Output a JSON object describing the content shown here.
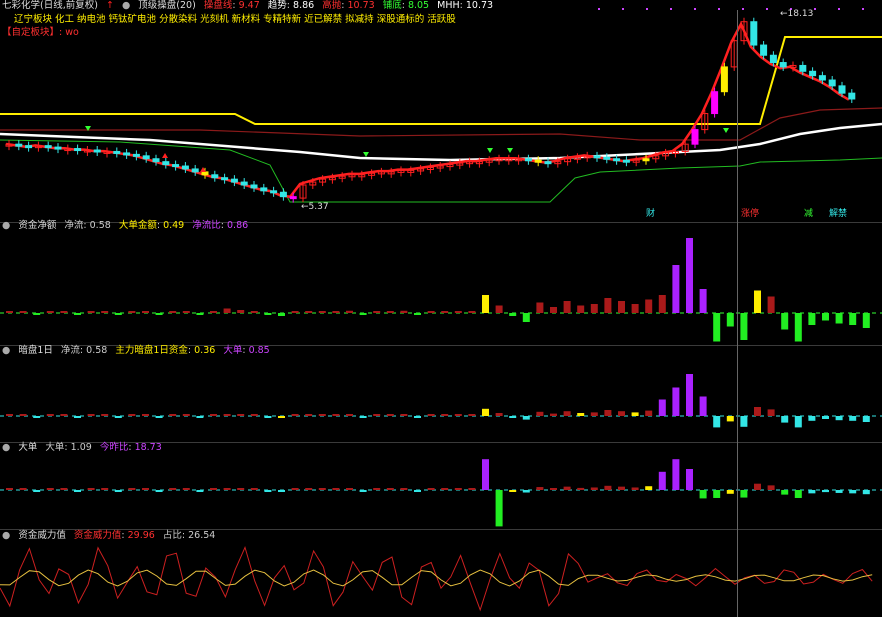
{
  "main": {
    "stock_name": "七彩化学(日线,前复权)",
    "indicator": "顶级操盘(20)",
    "values": [
      {
        "label": "操盘线",
        "value": "9.47",
        "color": "#ff3030"
      },
      {
        "label": "趋势",
        "value": "8.86",
        "color": "#ffffff"
      },
      {
        "label": "高抛",
        "value": "10.73",
        "color": "#ff3030"
      },
      {
        "label": "铺底",
        "value": "8.05",
        "color": "#33ff33"
      },
      {
        "label": "MHH",
        "value": "10.73",
        "color": "#ffffff"
      }
    ],
    "sector_text": "辽宁板块 化工 纳电池 钙钛矿电池 分散染料 光刻机 新材料 专精特新 近已解禁 拟减持 深股通标的 活跃股",
    "self_select": "【自定板块】: wo",
    "high_label": "18.13",
    "low_label": "5.37",
    "tags": [
      "财",
      "涨停",
      "减",
      "解禁"
    ],
    "colors": {
      "up": "#ff2020",
      "down": "#33e6e6",
      "yellow": "#ffee00",
      "magenta": "#ff00ff",
      "red": "#ff2020",
      "white": "#ffffff",
      "green": "#22bb22"
    }
  },
  "pane1": {
    "title": "资金净额",
    "values": [
      {
        "label": "净流",
        "value": "0.58",
        "color": "#cccccc"
      },
      {
        "label": "大单金额",
        "value": "0.49",
        "color": "#ffee00"
      },
      {
        "label": "净流比",
        "value": "0.86",
        "color": "#cc44ff"
      }
    ]
  },
  "pane2": {
    "title": "暗盘1日",
    "values": [
      {
        "label": "净流",
        "value": "0.58",
        "color": "#cccccc"
      },
      {
        "label": "主力暗盘1日资金",
        "value": "0.36",
        "color": "#ffee00"
      },
      {
        "label": "大单",
        "value": "0.85",
        "color": "#cc44ff"
      }
    ]
  },
  "pane3": {
    "title": "大单",
    "values": [
      {
        "label": "大单",
        "value": "1.09",
        "color": "#cccccc"
      },
      {
        "label": "今昨比",
        "value": "18.73",
        "color": "#cc44ff"
      }
    ]
  },
  "pane4": {
    "title": "资金威力值",
    "values": [
      {
        "label": "资金威力值",
        "value": "29.96",
        "color": "#ff3030"
      },
      {
        "label": "占比",
        "value": "26.54",
        "color": "#cccccc"
      }
    ]
  },
  "chart_data": {
    "type": "bar",
    "candles_close": [
      9.2,
      9.1,
      9.0,
      9.1,
      9.0,
      8.9,
      8.9,
      8.8,
      8.8,
      8.7,
      8.7,
      8.6,
      8.5,
      8.4,
      8.2,
      8.0,
      7.8,
      7.7,
      7.5,
      7.3,
      7.1,
      6.9,
      6.8,
      6.6,
      6.4,
      6.2,
      6.0,
      5.9,
      5.6,
      5.5,
      6.4,
      6.6,
      6.8,
      6.9,
      7.0,
      7.1,
      7.1,
      7.2,
      7.3,
      7.3,
      7.4,
      7.4,
      7.5,
      7.6,
      7.7,
      7.8,
      7.9,
      8.0,
      8.0,
      8.1,
      8.2,
      8.2,
      8.2,
      8.1,
      8.0,
      7.9,
      8.0,
      8.2,
      8.3,
      8.4,
      8.3,
      8.2,
      8.1,
      8.0,
      8.1,
      8.2,
      8.4,
      8.6,
      8.7,
      9.2,
      10.2,
      11.3,
      12.8,
      14.5,
      16.3,
      17.6,
      16.0,
      15.3,
      14.8,
      14.5,
      14.6,
      14.2,
      13.9,
      13.6,
      13.2,
      12.7,
      12.3
    ],
    "pane1_values": [
      0.1,
      0.05,
      -0.05,
      0.08,
      0.1,
      -0.1,
      0.05,
      0.12,
      -0.08,
      0.05,
      0.1,
      -0.05,
      0.08,
      0.06,
      -0.07,
      0.1,
      0.3,
      0.2,
      0.12,
      -0.1,
      -0.2,
      0.05,
      0.1,
      0.12,
      0.1,
      0.15,
      -0.1,
      0.08,
      0.12,
      0.15,
      -0.05,
      0.1,
      0.12,
      0.1,
      0.12,
      1.2,
      0.5,
      -0.2,
      -0.6,
      0.7,
      0.4,
      0.8,
      0.5,
      0.6,
      1.0,
      0.8,
      0.6,
      0.9,
      1.2,
      3.2,
      5.0,
      1.6,
      -1.9,
      -0.9,
      -1.8,
      1.5,
      1.1,
      -1.1,
      -1.9,
      -0.8,
      -0.5,
      -0.7,
      -0.8,
      -1.0
    ]
  }
}
